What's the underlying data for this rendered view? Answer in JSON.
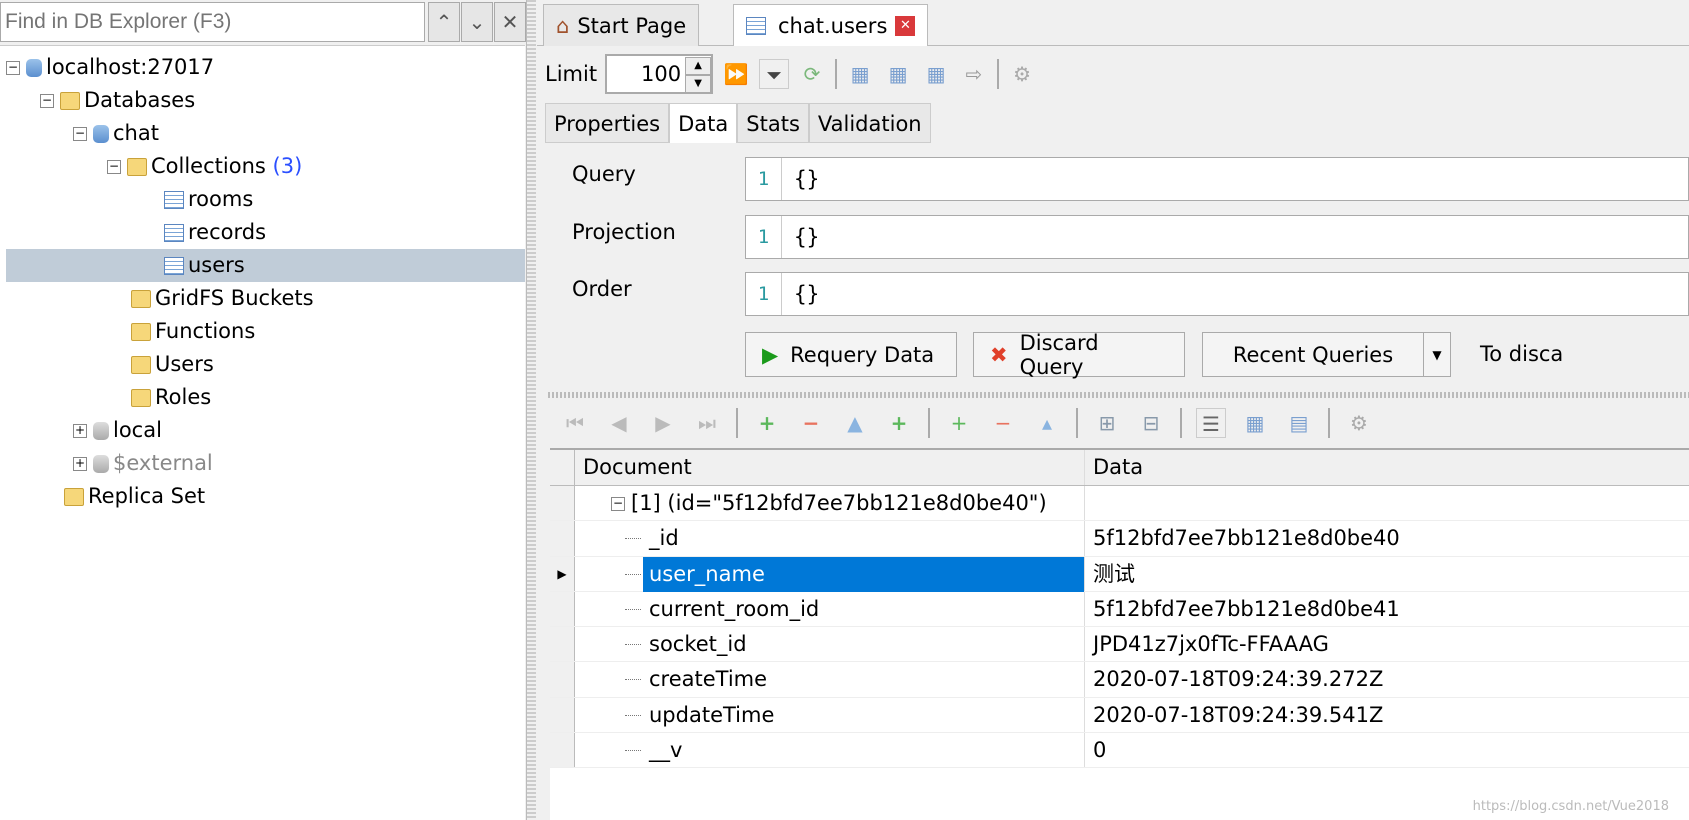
{
  "find": {
    "placeholder": "Find in DB Explorer (F3)"
  },
  "tree": {
    "server": "localhost:27017",
    "databases": "Databases",
    "db": "chat",
    "collections": "Collections",
    "collections_count": "(3)",
    "items": [
      "rooms",
      "records",
      "users"
    ],
    "gridfs": "GridFS Buckets",
    "functions": "Functions",
    "users": "Users",
    "roles": "Roles",
    "local": "local",
    "external": "$external",
    "replica": "Replica Set"
  },
  "tabs": [
    {
      "label": "Start Page"
    },
    {
      "label": "chat.users"
    }
  ],
  "toolbar": {
    "limit_label": "Limit",
    "limit_value": "100"
  },
  "subtabs": [
    "Properties",
    "Data",
    "Stats",
    "Validation"
  ],
  "query": {
    "query_label": "Query",
    "projection_label": "Projection",
    "order_label": "Order",
    "line": "1",
    "value": "{}"
  },
  "buttons": {
    "requery": "Requery Data",
    "discard": "Discard Query",
    "recent": "Recent Queries",
    "to_discard": "To disca"
  },
  "grid": {
    "col_document": "Document",
    "col_data": "Data",
    "doc": "[1] (id=\"5f12bfd7ee7bb121e8d0be40\")",
    "rows": [
      {
        "field": "_id",
        "value": "5f12bfd7ee7bb121e8d0be40"
      },
      {
        "field": "user_name",
        "value": "测试"
      },
      {
        "field": "current_room_id",
        "value": "5f12bfd7ee7bb121e8d0be41"
      },
      {
        "field": "socket_id",
        "value": "JPD41z7jx0fTc-FFAAAG"
      },
      {
        "field": "createTime",
        "value": "2020-07-18T09:24:39.272Z"
      },
      {
        "field": "updateTime",
        "value": "2020-07-18T09:24:39.541Z"
      },
      {
        "field": "__v",
        "value": "0"
      }
    ]
  },
  "watermark": "https://blog.csdn.net/Vue2018"
}
